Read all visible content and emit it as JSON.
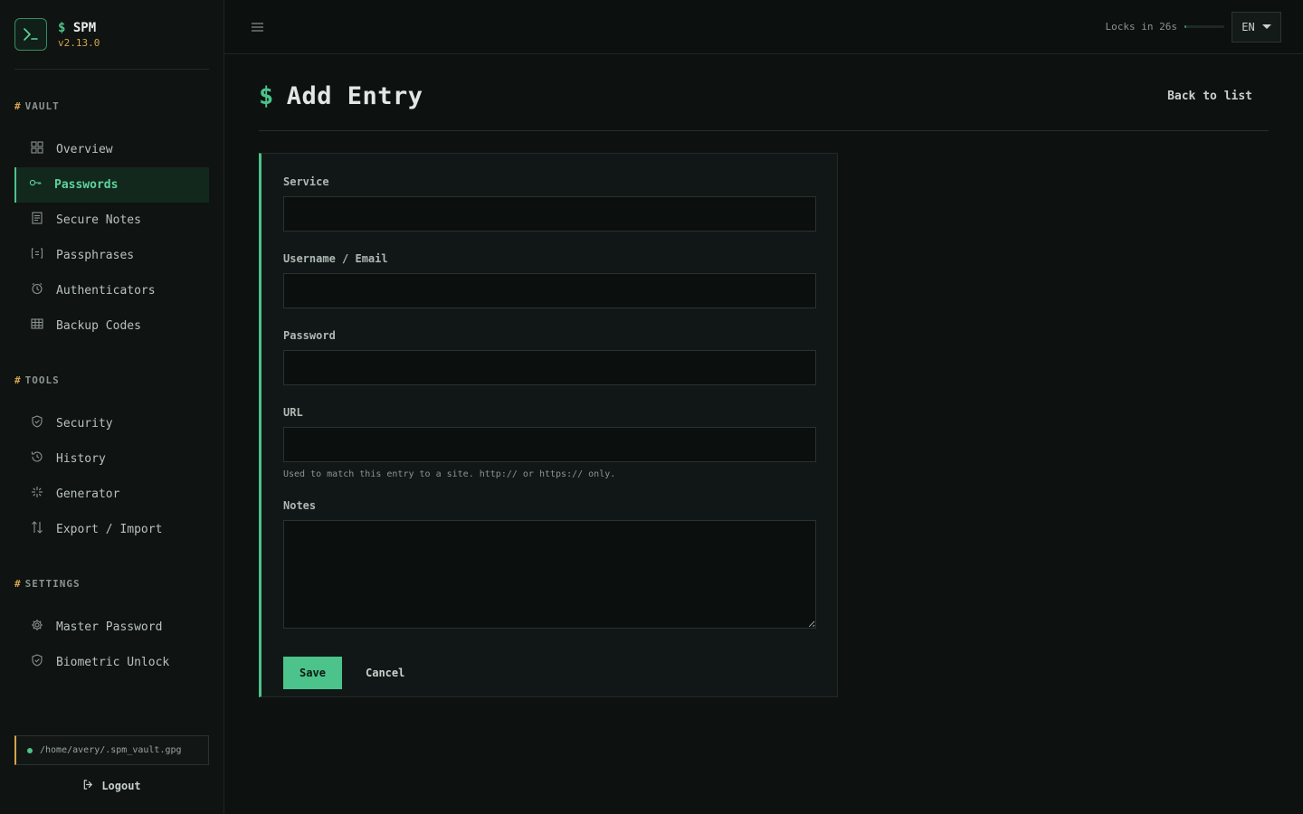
{
  "brand": {
    "prompt": "$",
    "name": "SPM",
    "version": "v2.13.0"
  },
  "sidebar": {
    "sections": [
      {
        "title": "VAULT",
        "items": [
          {
            "label": "Overview",
            "icon": "grid-icon",
            "active": false
          },
          {
            "label": "Passwords",
            "icon": "key-icon",
            "active": true
          },
          {
            "label": "Secure Notes",
            "icon": "note-icon",
            "active": false
          },
          {
            "label": "Passphrases",
            "icon": "bracket-icon",
            "active": false
          },
          {
            "label": "Authenticators",
            "icon": "timer-icon",
            "active": false
          },
          {
            "label": "Backup Codes",
            "icon": "table-icon",
            "active": false
          }
        ]
      },
      {
        "title": "TOOLS",
        "items": [
          {
            "label": "Security",
            "icon": "shield-icon",
            "active": false
          },
          {
            "label": "History",
            "icon": "history-icon",
            "active": false
          },
          {
            "label": "Generator",
            "icon": "sparkle-icon",
            "active": false
          },
          {
            "label": "Export / Import",
            "icon": "arrows-icon",
            "active": false
          }
        ]
      },
      {
        "title": "SETTINGS",
        "items": [
          {
            "label": "Master Password",
            "icon": "gear-icon",
            "active": false
          },
          {
            "label": "Biometric Unlock",
            "icon": "shield-icon",
            "active": false
          }
        ]
      }
    ],
    "vault_path": "/home/avery/.spm_vault.gpg",
    "logout_label": "Logout"
  },
  "topbar": {
    "lock_text": "Locks in 26s",
    "lock_progress": 0.05,
    "language": "EN"
  },
  "page": {
    "title": "Add Entry",
    "back_label": "Back to list"
  },
  "form": {
    "service_label": "Service",
    "service_value": "",
    "username_label": "Username / Email",
    "username_value": "",
    "password_label": "Password",
    "password_value": "",
    "url_label": "URL",
    "url_value": "",
    "url_helper": "Used to match this entry to a site. http:// or https:// only.",
    "notes_label": "Notes",
    "notes_value": "",
    "save_label": "Save",
    "cancel_label": "Cancel"
  },
  "colors": {
    "accent": "#4cc38a",
    "warning": "#d6a44c",
    "background": "#0d1110"
  }
}
